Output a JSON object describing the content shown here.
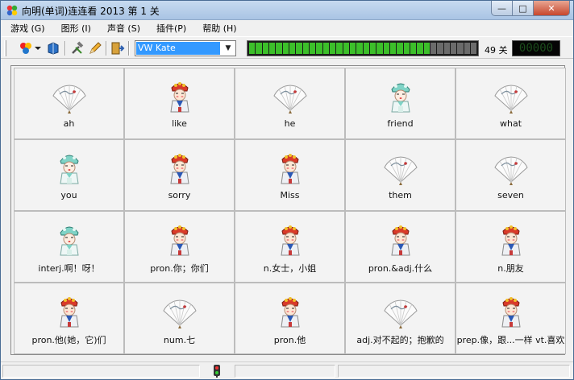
{
  "window": {
    "title": "向明(单词)连连看 2013  第 1 关",
    "min_label": "—",
    "max_label": "□",
    "close_label": "✕"
  },
  "menu": [
    {
      "label": "游戏 (G)"
    },
    {
      "label": "图形 (I)"
    },
    {
      "label": "声音 (S)"
    },
    {
      "label": "插件(P)"
    },
    {
      "label": "帮助 (H)"
    }
  ],
  "toolbar": {
    "voice_value": "VW Kate",
    "progress_total": 34,
    "progress_green": 27,
    "level_text": "49 关",
    "lcd_text": "00000"
  },
  "colors": {
    "accent": "#3399ff",
    "progress_on": "#3cbf2a",
    "progress_off": "#6b6b6b"
  },
  "board": {
    "tiles": [
      {
        "icon": "fan-icon",
        "label": "ah"
      },
      {
        "icon": "opera-figure-red-icon",
        "label": "like"
      },
      {
        "icon": "fan-icon",
        "label": "he"
      },
      {
        "icon": "opera-figure-teal-icon",
        "label": "friend"
      },
      {
        "icon": "fan-icon",
        "label": "what"
      },
      {
        "icon": "opera-figure-teal-icon",
        "label": "you"
      },
      {
        "icon": "opera-figure-red-icon",
        "label": "sorry"
      },
      {
        "icon": "opera-figure-red-icon",
        "label": "Miss"
      },
      {
        "icon": "fan-icon",
        "label": "them"
      },
      {
        "icon": "fan-icon",
        "label": "seven"
      },
      {
        "icon": "opera-figure-teal-icon",
        "label": "interj.啊！呀！"
      },
      {
        "icon": "opera-figure-red-icon",
        "label": "pron.你；你们"
      },
      {
        "icon": "opera-figure-red-icon",
        "label": "n.女士，小姐"
      },
      {
        "icon": "opera-figure-red-icon",
        "label": "pron.&adj.什么"
      },
      {
        "icon": "opera-figure-red-icon",
        "label": "n.朋友"
      },
      {
        "icon": "opera-figure-red-icon",
        "label": "pron.他(她，它)们"
      },
      {
        "icon": "fan-icon",
        "label": "num.七"
      },
      {
        "icon": "opera-figure-red-icon",
        "label": "pron.他"
      },
      {
        "icon": "fan-icon",
        "label": "adj.对不起的；抱歉的"
      },
      {
        "icon": "opera-figure-red-icon",
        "label": "prep.像，跟...一样 vt.喜欢"
      }
    ]
  }
}
